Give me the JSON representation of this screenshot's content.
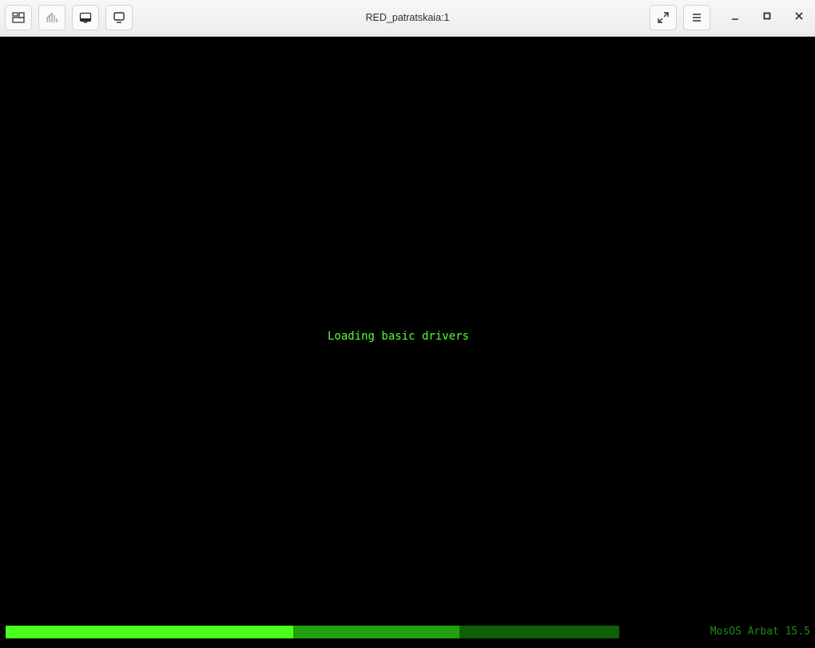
{
  "window": {
    "title": "RED_patratskaia:1"
  },
  "toolbar": {
    "left_buttons": [
      {
        "name": "overview-icon"
      },
      {
        "name": "send-keys-icon"
      },
      {
        "name": "keyboard-grab-icon"
      },
      {
        "name": "screen-icon"
      }
    ],
    "right_buttons": [
      {
        "name": "fullscreen-icon"
      },
      {
        "name": "menu-icon"
      }
    ],
    "window_controls": [
      "minimize-icon",
      "maximize-icon",
      "close-icon"
    ]
  },
  "console": {
    "message": "Loading basic drivers",
    "version": "MosOS Arbat 15.5",
    "colors": {
      "background": "#000000",
      "text": "#55ff33",
      "version_text": "#1f8a14",
      "progress_bright": "#4cff1a",
      "progress_mid": "#1fa10f",
      "progress_dark": "#0f5f07"
    },
    "progress": {
      "segments": [
        {
          "fraction": 0.469,
          "color": "#4cff1a"
        },
        {
          "fraction": 0.271,
          "color": "#1fa10f"
        },
        {
          "fraction": 0.26,
          "color": "#0f5f07"
        }
      ]
    }
  }
}
